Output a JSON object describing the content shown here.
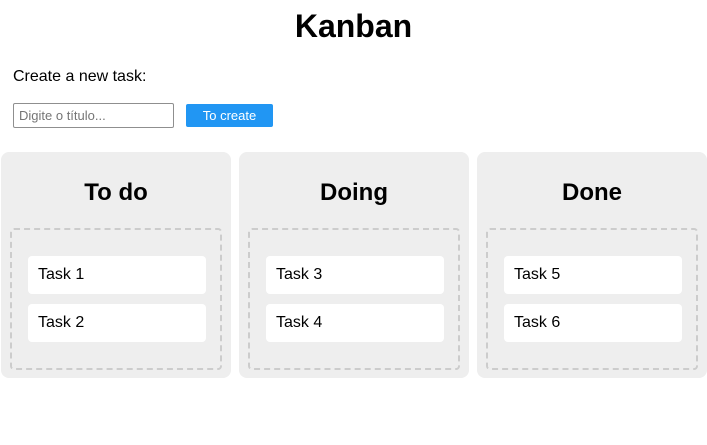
{
  "header": {
    "title": "Kanban"
  },
  "create_form": {
    "label": "Create a new task:",
    "input_value": "",
    "input_placeholder": "Digite o título...",
    "button_label": "To create",
    "button_color": "#2196f3"
  },
  "board": {
    "columns": [
      {
        "title": "To do",
        "tasks": [
          "Task 1",
          "Task 2"
        ]
      },
      {
        "title": "Doing",
        "tasks": [
          "Task 3",
          "Task 4"
        ]
      },
      {
        "title": "Done",
        "tasks": [
          "Task 5",
          "Task 6"
        ]
      }
    ],
    "column_background": "#eeeeee",
    "dropzone_border_color": "#cccccc"
  }
}
